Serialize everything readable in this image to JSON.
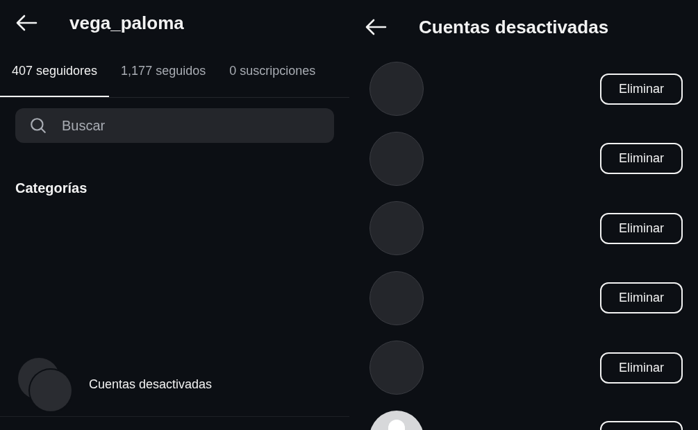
{
  "left": {
    "title": "vega_paloma",
    "tabs": [
      {
        "label": "407 seguidores",
        "selected": true
      },
      {
        "label": "1,177 seguidos",
        "selected": false
      },
      {
        "label": "0 suscripciones",
        "selected": false
      }
    ],
    "search": {
      "placeholder": "Buscar"
    },
    "section_title": "Categorías",
    "categories": [
      {
        "label": "Cuentas desactivadas"
      }
    ]
  },
  "right": {
    "title": "Cuentas desactivadas",
    "accounts": [
      {
        "kind": "blank",
        "button": "Eliminar"
      },
      {
        "kind": "blank",
        "button": "Eliminar"
      },
      {
        "kind": "blank",
        "button": "Eliminar"
      },
      {
        "kind": "blank",
        "button": "Eliminar"
      },
      {
        "kind": "blank",
        "button": "Eliminar"
      },
      {
        "kind": "default"
      }
    ]
  }
}
